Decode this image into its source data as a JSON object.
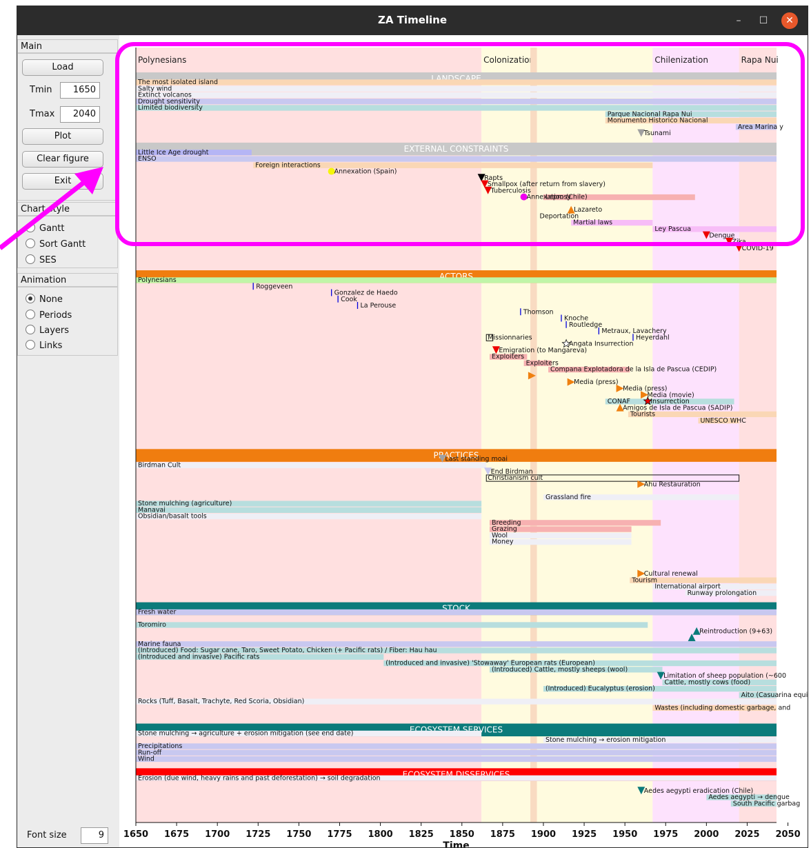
{
  "window": {
    "title": "ZA Timeline",
    "minimize_label": "–",
    "maximize_label": "☐",
    "close_label": "✕"
  },
  "sidebar": {
    "main": {
      "header": "Main",
      "load_label": "Load",
      "tmin_label": "Tmin",
      "tmin_value": "1650",
      "tmax_label": "Tmax",
      "tmax_value": "2040",
      "plot_label": "Plot",
      "clear_label": "Clear figure",
      "exit_label": "Exit"
    },
    "chart_style": {
      "header": "Chart style",
      "options": [
        "Gantt",
        "Sort Gantt",
        "SES"
      ],
      "selected": "Gantt"
    },
    "animation": {
      "header": "Animation",
      "options": [
        "None",
        "Periods",
        "Layers",
        "Links"
      ],
      "selected": "None"
    },
    "font_size_label": "Font size",
    "font_size_value": "9"
  },
  "annotation": {
    "highlight_color": "#ff00ff",
    "arrow_icon": "arrow-icon",
    "highlight": "rounded-rectangle-highlight"
  },
  "chart_data": {
    "type": "timeline-gantt",
    "title": "",
    "xlabel": "Time",
    "xlim": [
      1650,
      2043
    ],
    "ticks": [
      1650,
      1675,
      1700,
      1725,
      1750,
      1775,
      1800,
      1825,
      1850,
      1875,
      1900,
      1925,
      1950,
      1975,
      2000,
      2025,
      2050
    ],
    "periods": [
      {
        "name": "Polynesians",
        "start": 1650,
        "end": 1862,
        "color": "#ffe0e0"
      },
      {
        "name": "Colonization",
        "start": 1862,
        "end": 1967,
        "color": "#fffbdf"
      },
      {
        "name": "Chilenization",
        "start": 1967,
        "end": 2020,
        "color": "#fde2fd"
      },
      {
        "name": "Rapa Nui",
        "start": 2020,
        "end": 2043,
        "color": "#ffe0e0"
      }
    ],
    "highlight_band": {
      "start": 1892,
      "end": 1896,
      "color": "#f9dbc2"
    },
    "sections": [
      {
        "name": "LANDSCAPE",
        "row": 0,
        "color": "#c8c8c8"
      },
      {
        "name": "EXTERNAL CONSTRAINTS",
        "row": 11,
        "color": "#c8c8c8"
      },
      {
        "name": "ACTORS",
        "row": 31,
        "color": "#f07d0f"
      },
      {
        "name": "PRACTICES",
        "row": 59,
        "color": "#f07d0f"
      },
      {
        "name": "STOCK",
        "row": 83,
        "color": "#0b7b7b"
      },
      {
        "name": "ECOSYSTEM SERVICES",
        "row": 102,
        "color": "#0b7b7b"
      },
      {
        "name": "ECOSYSTEM DISSERVICES",
        "row": 109,
        "color": "#ff0000"
      }
    ],
    "bars": [
      {
        "label": "The most isolated island",
        "row": 1,
        "start": 1650,
        "end": 2043,
        "color": "#fad7b5"
      },
      {
        "label": "Salty wind",
        "row": 2,
        "start": 1650,
        "end": 2043,
        "color": "#efeff6"
      },
      {
        "label": "Extinct volcanos",
        "row": 3,
        "start": 1650,
        "end": 2043,
        "color": "#efeff6"
      },
      {
        "label": "Drought sensitivity",
        "row": 4,
        "start": 1650,
        "end": 2043,
        "color": "#c8c8f0"
      },
      {
        "label": "Limited biodiversity",
        "row": 5,
        "start": 1650,
        "end": 2043,
        "color": "#b7dede"
      },
      {
        "label": "Parque Nacional Rapa Nui",
        "row": 6,
        "start": 1938,
        "end": 2043,
        "color": "#b7dede"
      },
      {
        "label": "Monumento Historico Nacional",
        "row": 7,
        "start": 1938,
        "end": 2043,
        "color": "#fad7b5"
      },
      {
        "label": "Area Marina y",
        "row": 8,
        "start": 2018,
        "end": 2043,
        "color": "#c8c8f0"
      },
      {
        "label": "Little Ice Age drought",
        "row": 12,
        "start": 1650,
        "end": 1721,
        "color": "#b5b5f5"
      },
      {
        "label": "ENSO",
        "row": 13,
        "start": 1650,
        "end": 2043,
        "color": "#c8c8f0"
      },
      {
        "label": "Foreign interactions",
        "row": 14,
        "start": 1722,
        "end": 1967,
        "color": "#fad7b5"
      },
      {
        "label": "Leprosy",
        "row": 19,
        "start": 1900,
        "end": 1993,
        "color": "#f7b1b1"
      },
      {
        "label": "Martial laws",
        "row": 23,
        "start": 1917,
        "end": 1967,
        "color": "#f7bdf7"
      },
      {
        "label": "Ley Pascua",
        "row": 24,
        "start": 1967,
        "end": 2043,
        "color": "#f7bdf7"
      },
      {
        "label": "Polynesians",
        "row": 32,
        "start": 1650,
        "end": 2043,
        "color": "#c0f5a8"
      },
      {
        "label": "Exploiters",
        "row": 44,
        "start": 1867,
        "end": 1890,
        "color": "#f7b1b1"
      },
      {
        "label": "Exploiters",
        "row": 45,
        "start": 1888,
        "end": 1905,
        "color": "#f7b1b1"
      },
      {
        "label": "Compana Explotadora de la Isla de Pascua (CEDIP)",
        "row": 46,
        "start": 1903,
        "end": 1953,
        "color": "#f7b1b1"
      },
      {
        "label": "CONAF",
        "row": 51,
        "start": 1938,
        "end": 2017,
        "color": "#b7dede"
      },
      {
        "label": "Tourists",
        "row": 53,
        "start": 1952,
        "end": 2043,
        "color": "#fad7b5"
      },
      {
        "label": "UNESCO WHC",
        "row": 54,
        "start": 1995,
        "end": 2020,
        "color": "#fad7b5"
      },
      {
        "label": "Birdman Cult",
        "row": 61,
        "start": 1650,
        "end": 1865,
        "color": "#efeff6"
      },
      {
        "label": "Stone mulching (agriculture)",
        "row": 67,
        "start": 1650,
        "end": 1862,
        "color": "#b7dede"
      },
      {
        "label": "Manavai",
        "row": 68,
        "start": 1650,
        "end": 1862,
        "color": "#b7dede"
      },
      {
        "label": "Obsidian/basalt tools",
        "row": 69,
        "start": 1650,
        "end": 1862,
        "color": "#efeff6"
      },
      {
        "label": "Breeding",
        "row": 70,
        "start": 1867,
        "end": 1972,
        "color": "#f7b1b1"
      },
      {
        "label": "Grazing",
        "row": 71,
        "start": 1867,
        "end": 1954,
        "color": "#f7b1b1"
      },
      {
        "label": "Wool",
        "row": 72,
        "start": 1867,
        "end": 1954,
        "color": "#efeff6"
      },
      {
        "label": "Money",
        "row": 73,
        "start": 1867,
        "end": 1954,
        "color": "#efeff6"
      },
      {
        "label": "Grassland fire",
        "row": 66,
        "start": 1900,
        "end": 2020,
        "color": "#efeff6"
      },
      {
        "label": "Tourism",
        "row": 79,
        "start": 1953,
        "end": 2043,
        "color": "#fad7b5"
      },
      {
        "label": "International airport",
        "row": 80,
        "start": 1967,
        "end": 2043,
        "color": "#efeff6"
      },
      {
        "label": "Runway prolongation",
        "row": 81,
        "start": 1987,
        "end": 2043,
        "color": "#efeff6"
      },
      {
        "label": "Fresh water",
        "row": 84,
        "start": 1650,
        "end": 2043,
        "color": "#c8c8f0"
      },
      {
        "label": "Toromiro",
        "row": 86,
        "start": 1650,
        "end": 1964,
        "color": "#b7dede"
      },
      {
        "label": "Marine fauna",
        "row": 89,
        "start": 1650,
        "end": 2043,
        "color": "#c8c8f0"
      },
      {
        "label": "(Introduced) Food: Sugar cane, Taro, Sweet Potato, Chicken (+ Pacific rats) / Fiber: Hau hau",
        "row": 90,
        "start": 1650,
        "end": 2043,
        "color": "#b7dede"
      },
      {
        "label": "(Introduced and invasive) Pacific rats",
        "row": 91,
        "start": 1650,
        "end": 1802,
        "color": "#b7dede"
      },
      {
        "label": "(Introduced and invasive) 'Stowaway' European rats (European)",
        "row": 92,
        "start": 1802,
        "end": 2043,
        "color": "#b7dede"
      },
      {
        "label": "(Introduced) Cattle, mostly sheeps (wool)",
        "row": 93,
        "start": 1867,
        "end": 1973,
        "color": "#b7dede"
      },
      {
        "label": "Cattle, mostly cows (food)",
        "row": 95,
        "start": 1973,
        "end": 2043,
        "color": "#b7dede"
      },
      {
        "label": "(Introduced) Eucalyptus (erosion)",
        "row": 96,
        "start": 1900,
        "end": 2043,
        "color": "#b7dede"
      },
      {
        "label": "Aito (Casuarina equiset",
        "row": 97,
        "start": 2020,
        "end": 2043,
        "color": "#b7dede"
      },
      {
        "label": "Rocks (Tuff, Basalt, Trachyte, Red Scoria, Obsidian)",
        "row": 98,
        "start": 1650,
        "end": 2043,
        "color": "#efeff6"
      },
      {
        "label": "Wastes (including domestic garbage, and",
        "row": 99,
        "start": 1967,
        "end": 2043,
        "color": "#fad7b5"
      },
      {
        "label": "Stone mulching → agriculture + erosion mitigation (see end date)",
        "row": 103,
        "start": 1650,
        "end": 1862,
        "color": "#efeff6"
      },
      {
        "label": "Stone mulching → erosion mitigation",
        "row": 104,
        "start": 1900,
        "end": 2043,
        "color": "#efeff6"
      },
      {
        "label": "Precipitations",
        "row": 105,
        "start": 1650,
        "end": 2043,
        "color": "#c8c8f0"
      },
      {
        "label": "Run-off",
        "row": 106,
        "start": 1650,
        "end": 2043,
        "color": "#c8c8f0"
      },
      {
        "label": "Wind",
        "row": 107,
        "start": 1650,
        "end": 2043,
        "color": "#c8c8f0"
      },
      {
        "label": "Erosion (due wind, heavy rains and past deforestation) → soil degradation",
        "row": 110,
        "start": 1650,
        "end": 2043,
        "color": "#efeff6"
      },
      {
        "label": "Aedes aegypti → dengue",
        "row": 113,
        "start": 2000,
        "end": 2043,
        "color": "#b7dede"
      },
      {
        "label": "South Pacific garbag",
        "row": 114,
        "start": 2015,
        "end": 2043,
        "color": "#b7dede"
      }
    ],
    "outline_bars": [
      {
        "label": "Missionnaries",
        "row": 41,
        "start": 1865,
        "end": 1869
      },
      {
        "label": "Christianism cult",
        "row": 63,
        "start": 1865,
        "end": 2020
      }
    ],
    "events": [
      {
        "label": "Tsunami",
        "row": 9,
        "year": 1960,
        "marker": "tri-down",
        "color": "#a0a0a0"
      },
      {
        "label": "Annexation (Spain)",
        "row": 15,
        "year": 1770,
        "marker": "circle",
        "color": "#f5f50a"
      },
      {
        "label": "Rapts",
        "row": 16,
        "year": 1862,
        "marker": "tri-down",
        "color": "#000000"
      },
      {
        "label": "Smallpox (after return from slavery)",
        "row": 17,
        "year": 1864,
        "marker": "tri-down",
        "color": "#ee0000"
      },
      {
        "label": "Tuberculosis",
        "row": 18,
        "year": 1866,
        "marker": "tri-down",
        "color": "#ee0000"
      },
      {
        "label": "Annexation (Chile)",
        "row": 19,
        "year": 1888,
        "marker": "circle",
        "color": "#f000f0"
      },
      {
        "label": "Lazareto",
        "row": 21,
        "year": 1917,
        "marker": "tri-up",
        "color": "#ef8010"
      },
      {
        "label": "Deportation",
        "row": 22,
        "year": 1896,
        "marker": "none",
        "color": "#000000"
      },
      {
        "label": "Dengue",
        "row": 25,
        "year": 2000,
        "marker": "tri-down",
        "color": "#ee0000"
      },
      {
        "label": "Zika",
        "row": 26,
        "year": 2014,
        "marker": "tri-down",
        "color": "#ee0000"
      },
      {
        "label": "COVID-19",
        "row": 27,
        "year": 2020,
        "marker": "tri-down",
        "color": "#ee0000"
      },
      {
        "label": "Roggeveen",
        "row": 33,
        "year": 1722,
        "marker": "tick",
        "color": "#0000dd"
      },
      {
        "label": "Gonzalez de Haedo",
        "row": 34,
        "year": 1770,
        "marker": "tick",
        "color": "#0000dd"
      },
      {
        "label": "Cook",
        "row": 35,
        "year": 1774,
        "marker": "tick",
        "color": "#0000dd"
      },
      {
        "label": "La Perouse",
        "row": 36,
        "year": 1786,
        "marker": "tick",
        "color": "#0000dd"
      },
      {
        "label": "Thomson",
        "row": 37,
        "year": 1886,
        "marker": "tick",
        "color": "#0000dd"
      },
      {
        "label": "Knoche",
        "row": 38,
        "year": 1911,
        "marker": "tick",
        "color": "#0000dd"
      },
      {
        "label": "Routledge",
        "row": 39,
        "year": 1914,
        "marker": "tick",
        "color": "#0000dd"
      },
      {
        "label": "Metraux, Lavachery",
        "row": 40,
        "year": 1934,
        "marker": "tick",
        "color": "#0000dd"
      },
      {
        "label": "Heyerdahl",
        "row": 41,
        "year": 1955,
        "marker": "tick",
        "color": "#0000dd"
      },
      {
        "label": "Angata Insurrection",
        "row": 42,
        "year": 1914,
        "marker": "star",
        "color": "#ffffff"
      },
      {
        "label": "Emigration (to Mangareva)",
        "row": 43,
        "year": 1871,
        "marker": "tri-down",
        "color": "#ee0000"
      },
      {
        "label": "Media (press)",
        "row": 48,
        "year": 1917,
        "marker": "tri-right",
        "color": "#ef8010"
      },
      {
        "label": "Media (press)",
        "row": 49,
        "year": 1947,
        "marker": "tri-right",
        "color": "#ef8010"
      },
      {
        "label": "Media (movie)",
        "row": 50,
        "year": 1962,
        "marker": "tri-right",
        "color": "#ef8010"
      },
      {
        "label": "Insurrection",
        "row": 51,
        "year": 1964,
        "marker": "star",
        "color": "#ee0000"
      },
      {
        "label": "Amigos de Isla de Pascua (SADIP)",
        "row": 52,
        "year": 1947,
        "marker": "tri-up",
        "color": "#ef8010"
      },
      {
        "label": "Last standing moai",
        "row": 60,
        "year": 1838,
        "marker": "tri-down",
        "color": "#a0a0a0"
      },
      {
        "label": "End Birdman",
        "row": 62,
        "year": 1866,
        "marker": "tri-down",
        "color": "#c8c8f0"
      },
      {
        "label": "Ahu Restauration",
        "row": 64,
        "year": 1960,
        "marker": "tri-right",
        "color": "#ef8010"
      },
      {
        "label": "Cultural renewal",
        "row": 78,
        "year": 1960,
        "marker": "tri-right",
        "color": "#ef8010"
      },
      {
        "label": "Reintroduction (9+63)",
        "row": 87,
        "year": 1994,
        "marker": "tri-up",
        "color": "#0b7b7b"
      },
      {
        "label": "Limitation of sheep population (~600",
        "row": 94,
        "year": 1972,
        "marker": "tri-down",
        "color": "#0b7b7b"
      },
      {
        "label": "Aedes aegypti eradication (Chile)",
        "row": 112,
        "year": 1960,
        "marker": "tri-down",
        "color": "#0b7b7b"
      }
    ],
    "extra_markers": [
      {
        "row": 47,
        "year": 1893,
        "marker": "tri-right",
        "color": "#ef8010"
      },
      {
        "row": 88,
        "year": 1991,
        "marker": "tri-up",
        "color": "#0b7b7b"
      }
    ]
  }
}
